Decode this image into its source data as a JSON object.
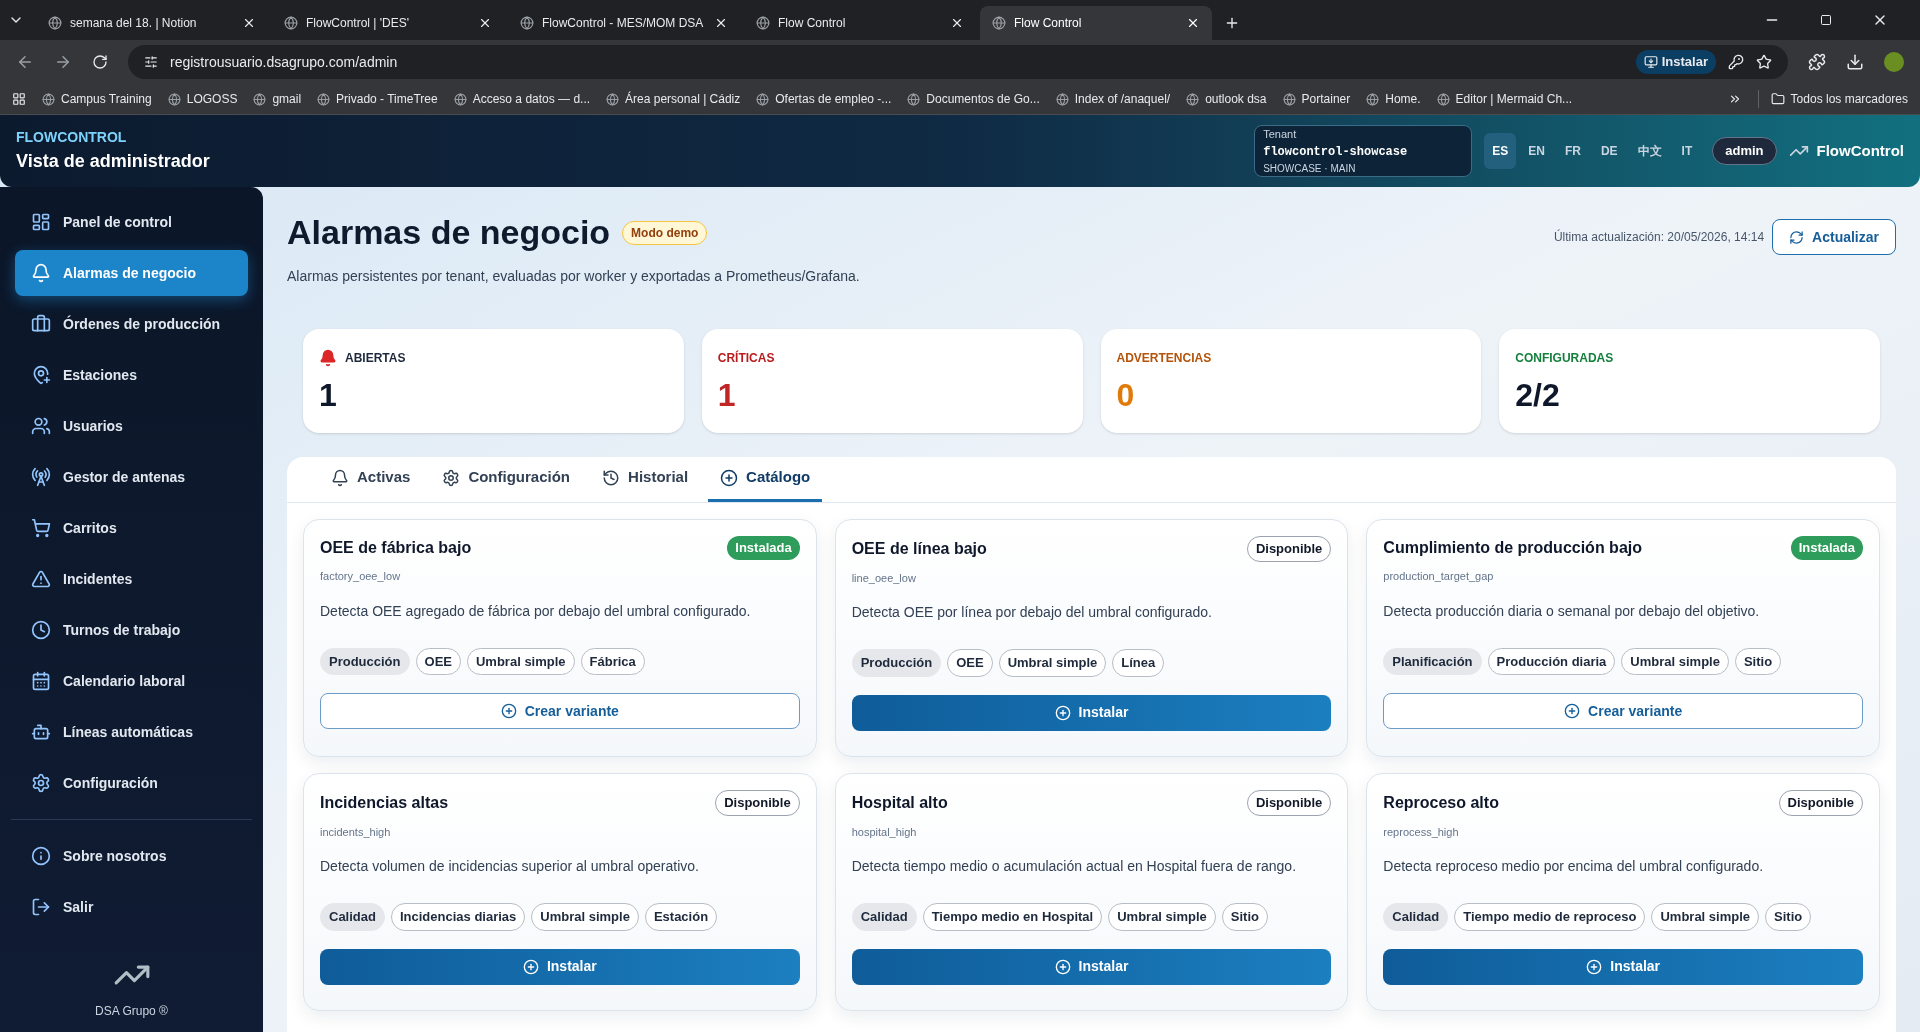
{
  "browser": {
    "tabs": [
      {
        "title": "semana del 18. | Notion",
        "selected": false
      },
      {
        "title": "FlowControl | 'DES'",
        "selected": false
      },
      {
        "title": "FlowControl - MES/MOM DSA",
        "selected": false
      },
      {
        "title": "Flow Control",
        "selected": false
      },
      {
        "title": "Flow Control",
        "selected": true
      }
    ],
    "url": "registrousuario.dsagrupo.com/admin",
    "install": "Instalar",
    "bookmarks": [
      "Campus Training",
      "LOGOSS",
      "gmail",
      "Privado - TimeTree",
      "Acceso a datos — d...",
      "Área personal | Cádiz",
      "Ofertas de empleo -...",
      "Documentos de Go...",
      "Index of /anaquel/",
      "outlook dsa",
      "Portainer",
      "Home.",
      "Editor | Mermaid Ch..."
    ],
    "all_bookmarks": "Todos los marcadores"
  },
  "header": {
    "brand": "FLOWCONTROL",
    "subtitle": "Vista de administrador",
    "tenant_label": "Tenant",
    "tenant": "flowcontrol-showcase",
    "tenant_scope": "SHOWCASE · MAIN",
    "languages": [
      {
        "code": "ES",
        "selected": true
      },
      {
        "code": "EN",
        "selected": false
      },
      {
        "code": "FR",
        "selected": false
      },
      {
        "code": "DE",
        "selected": false
      },
      {
        "code": "中文",
        "selected": false
      },
      {
        "code": "IT",
        "selected": false
      }
    ],
    "user": "admin",
    "product": "FlowControl"
  },
  "sidebar": {
    "items": [
      {
        "label": "Panel de control",
        "kind": "dashboard",
        "selected": false
      },
      {
        "label": "Alarmas de negocio",
        "kind": "bell",
        "selected": true
      },
      {
        "label": "Órdenes de producción",
        "kind": "briefcase",
        "selected": false
      },
      {
        "label": "Estaciones",
        "kind": "pin",
        "selected": false
      },
      {
        "label": "Usuarios",
        "kind": "users",
        "selected": false
      },
      {
        "label": "Gestor de antenas",
        "kind": "antenna",
        "selected": false
      },
      {
        "label": "Carritos",
        "kind": "cart",
        "selected": false
      },
      {
        "label": "Incidentes",
        "kind": "warning",
        "selected": false
      },
      {
        "label": "Turnos de trabajo",
        "kind": "clock",
        "selected": false
      },
      {
        "label": "Calendario laboral",
        "kind": "calendar",
        "selected": false
      },
      {
        "label": "Líneas automáticas",
        "kind": "robot",
        "selected": false
      },
      {
        "label": "Configuración",
        "kind": "gear",
        "selected": false
      }
    ],
    "bottom_items": [
      {
        "label": "Sobre nosotros",
        "kind": "info",
        "selected": false
      },
      {
        "label": "Salir",
        "kind": "logout",
        "selected": false
      }
    ],
    "footer": "DSA Grupo ®"
  },
  "page": {
    "title": "Alarmas de negocio",
    "badge": "Modo demo",
    "description": "Alarmas persistentes por tenant, evaluadas por worker y exportadas a Prometheus/Grafana.",
    "updated": "Última actualización: 20/05/2026, 14:14",
    "refresh": "Actualizar"
  },
  "stats": [
    {
      "label": "ABIERTAS",
      "value": "1",
      "kind": "open"
    },
    {
      "label": "CRÍTICAS",
      "value": "1",
      "kind": "critical"
    },
    {
      "label": "ADVERTENCIAS",
      "value": "0",
      "kind": "warning"
    },
    {
      "label": "CONFIGURADAS",
      "value": "2/2",
      "kind": "configured"
    }
  ],
  "tabs": [
    {
      "label": "Activas",
      "kind": "bell",
      "selected": false
    },
    {
      "label": "Configuración",
      "kind": "gear",
      "selected": false
    },
    {
      "label": "Historial",
      "kind": "history",
      "selected": false
    },
    {
      "label": "Catálogo",
      "kind": "plus",
      "selected": true
    }
  ],
  "cards": [
    {
      "title": "OEE de fábrica bajo",
      "status": "Instalada",
      "installed": true,
      "code": "factory_oee_low",
      "description": "Detecta OEE agregado de fábrica por debajo del umbral configurado.",
      "tags": [
        "Producción",
        "OEE",
        "Umbral simple",
        "Fábrica"
      ],
      "action": "Crear variante"
    },
    {
      "title": "OEE de línea bajo",
      "status": "Disponible",
      "installed": false,
      "code": "line_oee_low",
      "description": "Detecta OEE por línea por debajo del umbral configurado.",
      "tags": [
        "Producción",
        "OEE",
        "Umbral simple",
        "Línea"
      ],
      "action": "Instalar"
    },
    {
      "title": "Cumplimiento de producción bajo",
      "status": "Instalada",
      "installed": true,
      "code": "production_target_gap",
      "description": "Detecta producción diaria o semanal por debajo del objetivo.",
      "tags": [
        "Planificación",
        "Producción diaria",
        "Umbral simple",
        "Sitio"
      ],
      "action": "Crear variante"
    },
    {
      "title": "Incidencias altas",
      "status": "Disponible",
      "installed": false,
      "code": "incidents_high",
      "description": "Detecta volumen de incidencias superior al umbral operativo.",
      "tags": [
        "Calidad",
        "Incidencias diarias",
        "Umbral simple",
        "Estación"
      ],
      "action": "Instalar"
    },
    {
      "title": "Hospital alto",
      "status": "Disponible",
      "installed": false,
      "code": "hospital_high",
      "description": "Detecta tiempo medio o acumulación actual en Hospital fuera de rango.",
      "tags": [
        "Calidad",
        "Tiempo medio en Hospital",
        "Umbral simple",
        "Sitio"
      ],
      "action": "Instalar"
    },
    {
      "title": "Reproceso alto",
      "status": "Disponible",
      "installed": false,
      "code": "reprocess_high",
      "description": "Detecta reproceso medio por encima del umbral configurado.",
      "tags": [
        "Calidad",
        "Tiempo medio de reproceso",
        "Umbral simple",
        "Sitio"
      ],
      "action": "Instalar"
    }
  ]
}
